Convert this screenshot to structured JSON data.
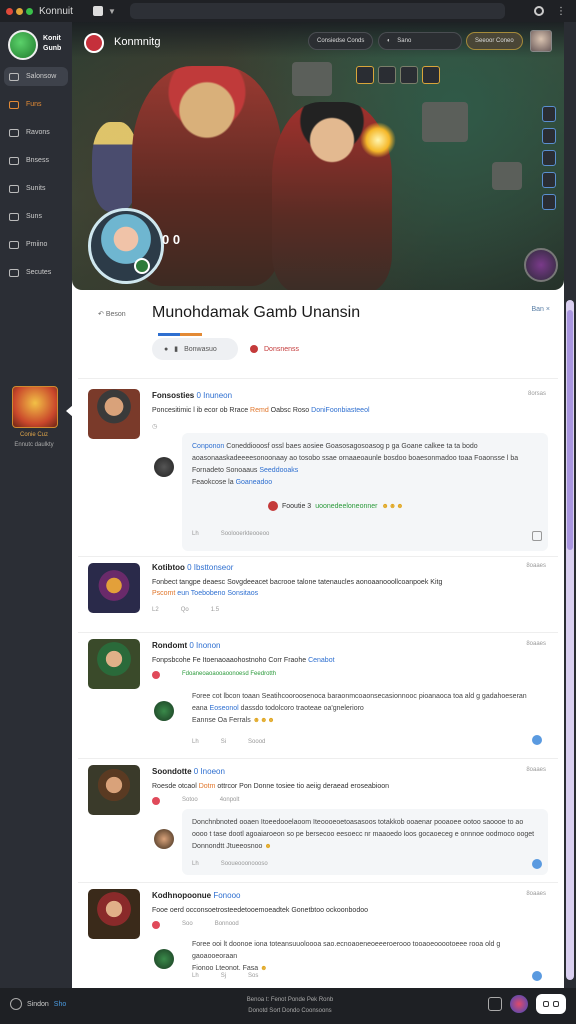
{
  "browser": {
    "tab_title": "Konnuit",
    "dot_colors": [
      "#e04a3a",
      "#e0a63a",
      "#3ac04a"
    ]
  },
  "sidebar": {
    "logo_text": "Konit Gunb",
    "items": [
      {
        "label": "Salonsow",
        "active": true
      },
      {
        "label": "Funs",
        "accent": true
      },
      {
        "label": "Ravons"
      },
      {
        "label": "Bnsess"
      },
      {
        "label": "Sunits"
      },
      {
        "label": "Suns"
      },
      {
        "label": "Pmiino"
      },
      {
        "label": "Secutes"
      }
    ],
    "card_title": "Conie Cuz",
    "card_subtitle": "Ennutc daulkty"
  },
  "hero": {
    "app_title": "Konmnitg",
    "pill1": "Consiedse Conds",
    "pill2": "Sano",
    "pill3": "Seeoor Coneo",
    "score": "0 0"
  },
  "game": {
    "back_label": "Beson",
    "title": "Munohdamak Gamb Unansin",
    "head_right": "Ban ×",
    "action_primary": "Bonwasuo",
    "action_secondary": "Donsnenss"
  },
  "posts": [
    {
      "name": "Fonsosties",
      "tag": "0 Inuneon",
      "time": "8orsas",
      "text_a": "Poncesitimic l ib ecor ob Rrace ",
      "text_hl1": "Remd",
      "text_b": " Oabsc Roso ",
      "text_hl2": "DoniFoonbiasteeol",
      "reply_hl": "Conponon",
      "reply_text": " Coneddiooosf ossl baes aosiee Goasosagosoasog p ga Goane calkee ta ta bodo aoasonaaskadeeeesonoonaay ao tosobo ssae ornaaeoaunle bosdoo boaesonmadoo toaa Foaonsse l ba Fornadeto Sonoaaus",
      "reply_hl2": "Seeddooaks",
      "reply_tail": "Feaokcose la ",
      "reply_hl3": "Goaneadoo",
      "reply_center": "Fooutie 3 ",
      "reply_center_hl": "uoonedeeloneonner",
      "reply_meta1": "Lh",
      "reply_meta2": "Soolooerkteooeoo"
    },
    {
      "name": "Kotibtoo",
      "tag": "0 Ibsttonseor",
      "time": "8oaaes",
      "text_a": "Fonbect tangpe deaesc Sovgdeeacet bacrooe talone tatenaucles aonoaanooollcoanpoek Kitg ",
      "text_hl1": "Pscomt",
      "text_b": " ",
      "text_hl2": "eun Toebobeno Sonsitaos",
      "meta1": "L2",
      "meta2": "Qo",
      "meta3": "1.5"
    },
    {
      "name": "Rondomt",
      "tag": "0 Inonon",
      "time": "8oaaes",
      "text_a": "Fonpsbcohe Fe Itoenaoaaohostnoho Corr Fraohe ",
      "text_hl2": "Cenabot",
      "meta_green": "Fdoaneoaoaooaoonoesd Feedrotth",
      "reply_text": "Foree cot lbcon toaan Seatihcooroosenoca baraonmcoaonsecasionnooc pioanaoca toa ald g gadahoeseran eana ",
      "reply_hl": "Eoseonol",
      "reply_text2": " dassdo todolcoro traoteae oa'gnelerioro",
      "reply_tail": "Eannse Oa Ferrals",
      "reply_meta1": "Lh",
      "reply_meta2": "Si",
      "reply_meta3": "Soood"
    },
    {
      "name": "Soondotte",
      "tag": "0 Inoeon",
      "time": "8oaaes",
      "text_a": "Roesde otcaol ",
      "text_hl1": "Dotm",
      "text_b": " ottrcor Pon Donne tosiee tio aeiig deraead eroseabioon",
      "meta1": "Sotoo",
      "meta2": "4onpolt",
      "reply_text": "Donchnbnoted ooaen Itoeedooelaoom Iteoooeoetoasasoos totakkob ooaenar pooaoee ootoo saoooe to ao oooo t tase dootl agoaiaroeon so pe bersecoo eesoecc nr maaoedo loos gocaoeceg e onnnoe oodmoco ooget",
      "reply_tail": "Donnondtt Jtueeosnoo",
      "reply_meta1": "Lh",
      "reply_meta2": "Sooueooonoooso"
    },
    {
      "name": "Kodhnopoonue",
      "tag": "Fonooo",
      "time": "8oaaes",
      "text_a": "Fooe oerd occonsoetrosteedetooemoeadtek Gonetbtoo ockoonbodoo",
      "meta1": "Soo",
      "meta2": "Bonnood",
      "reply_text": "Foree ooi lt doonoe iona toteansuuoloooa sao.ecnoaoeneoeeeroerooo tooaoeooootoeee rooa old g gaoaooeoraan",
      "reply_tail": "Fionoo Lteonot. Fasa",
      "reply_meta1": "Lh",
      "reply_meta2": "Sj",
      "reply_meta3": "Sos"
    }
  ],
  "bottom": {
    "left_label": "Sindon ",
    "left_hl": "Sho",
    "center_line1": "Benoa t: Fenot Ponde Pek Ronb",
    "center_line2": "Donotd Sort Dondo Coonsoons"
  }
}
